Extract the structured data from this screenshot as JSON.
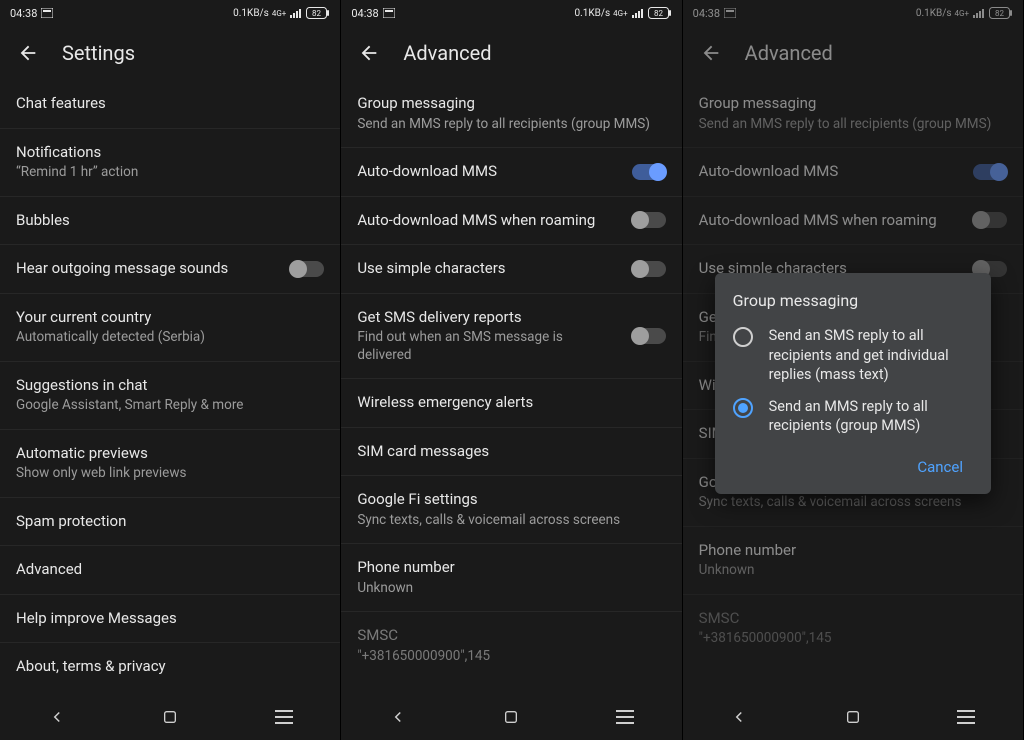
{
  "status": {
    "time": "04:38",
    "net": "0.1KB/s",
    "signal_sup": "4G+",
    "battery": "82"
  },
  "nav": {
    "back": "back",
    "home": "home",
    "recent": "recent"
  },
  "screen1": {
    "title": "Settings",
    "items": [
      {
        "title": "Chat features"
      },
      {
        "title": "Notifications",
        "sub": "“Remind 1 hr” action"
      },
      {
        "title": "Bubbles"
      },
      {
        "title": "Hear outgoing message sounds",
        "toggle": "off"
      },
      {
        "title": "Your current country",
        "sub": "Automatically detected (Serbia)"
      },
      {
        "title": "Suggestions in chat",
        "sub": "Google Assistant, Smart Reply & more"
      },
      {
        "title": "Automatic previews",
        "sub": "Show only web link previews"
      },
      {
        "title": "Spam protection"
      },
      {
        "title": "Advanced"
      },
      {
        "title": "Help improve Messages"
      },
      {
        "title": "About, terms & privacy"
      }
    ]
  },
  "screen2": {
    "title": "Advanced",
    "items": [
      {
        "title": "Group messaging",
        "sub": "Send an MMS reply to all recipients (group MMS)"
      },
      {
        "title": "Auto-download MMS",
        "toggle": "on"
      },
      {
        "title": "Auto-download MMS when roaming",
        "toggle": "off"
      },
      {
        "title": "Use simple characters",
        "toggle": "off"
      },
      {
        "title": "Get SMS delivery reports",
        "sub": "Find out when an SMS message is delivered",
        "toggle": "off"
      },
      {
        "title": "Wireless emergency alerts"
      },
      {
        "title": "SIM card messages"
      },
      {
        "title": "Google Fi settings",
        "sub": "Sync texts, calls & voicemail across screens"
      },
      {
        "title": "Phone number",
        "sub": "Unknown"
      },
      {
        "title": "SMSC",
        "sub": "\"+381650000900\",145",
        "dim": true
      }
    ]
  },
  "screen3": {
    "title": "Advanced",
    "dialog": {
      "title": "Group messaging",
      "options": [
        {
          "text": "Send an SMS reply to all recipients and get individual replies (mass text)",
          "selected": false
        },
        {
          "text": "Send an MMS reply to all recipients (group MMS)",
          "selected": true
        }
      ],
      "cancel": "Cancel"
    }
  }
}
